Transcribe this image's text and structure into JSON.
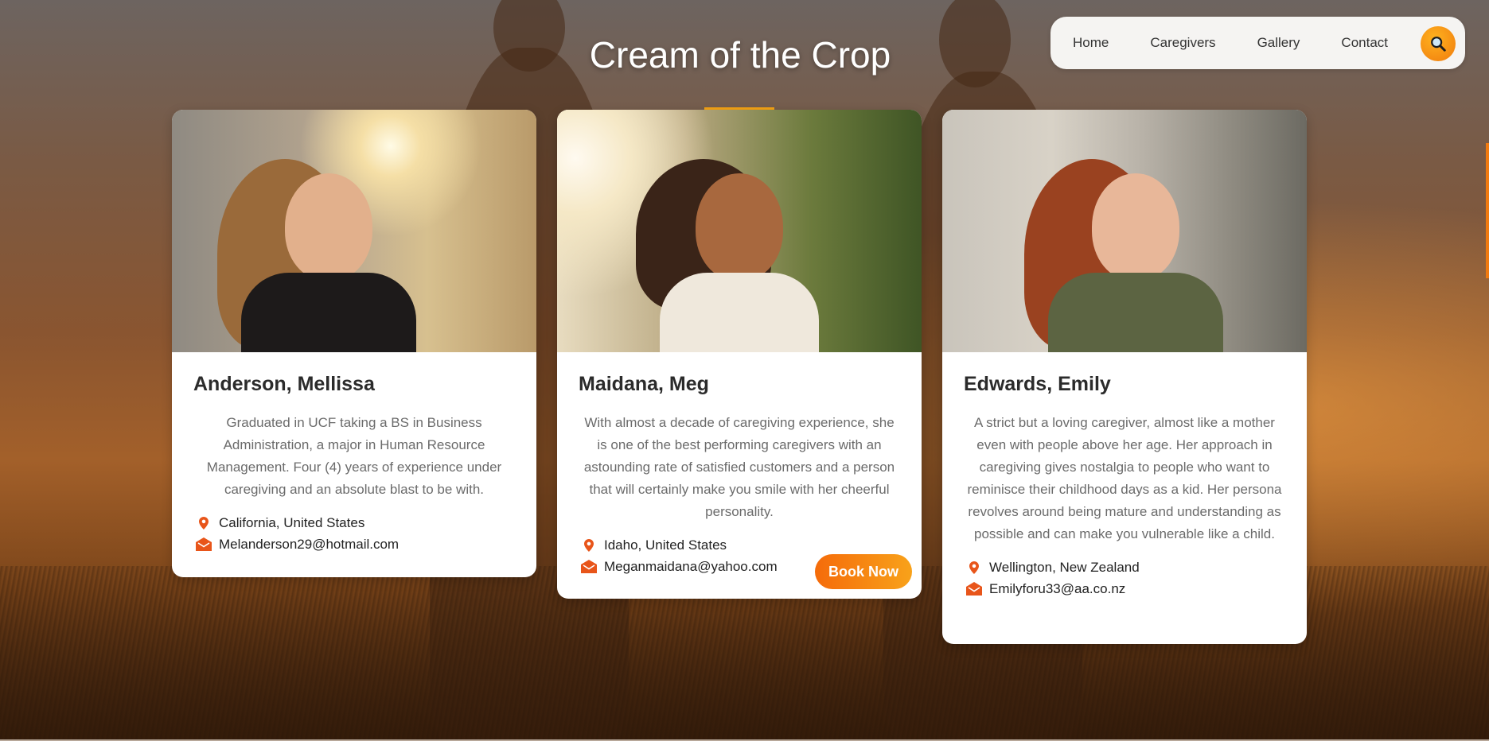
{
  "page": {
    "title": "Cream of the Crop"
  },
  "nav": {
    "items": [
      "Home",
      "Caregivers",
      "Gallery",
      "Contact"
    ],
    "search_icon": "magnifying-glass-icon"
  },
  "colors": {
    "accent": "#f6a313",
    "accent_dark": "#f07b0d",
    "icon": "#e8551a"
  },
  "caregivers": [
    {
      "name": "Anderson, Mellissa",
      "description": "Graduated in UCF taking a BS in Business Administration, a major in Human Resource Management. Four (4) years of experience under caregiving and an absolute blast to be with.",
      "location": "California, United States",
      "email": "Melanderson29@hotmail.com"
    },
    {
      "name": "Maidana, Meg",
      "description": "With almost a decade of caregiving experience, she is one of the best performing caregivers with an astounding rate of satisfied customers and a person that will certainly make you smile with her cheerful personality.",
      "location": "Idaho, United States",
      "email": "Meganmaidana@yahoo.com",
      "button": "Book Now"
    },
    {
      "name": "Edwards, Emily",
      "description": "A strict but a loving caregiver, almost like a mother even with people above her age. Her approach in caregiving gives nostalgia to people who want to reminisce their childhood days as a kid. Her persona revolves around being mature and understanding as possible and can make you vulnerable like a child.",
      "location": "Wellington, New Zealand",
      "email": "Emilyforu33@aa.co.nz"
    }
  ]
}
